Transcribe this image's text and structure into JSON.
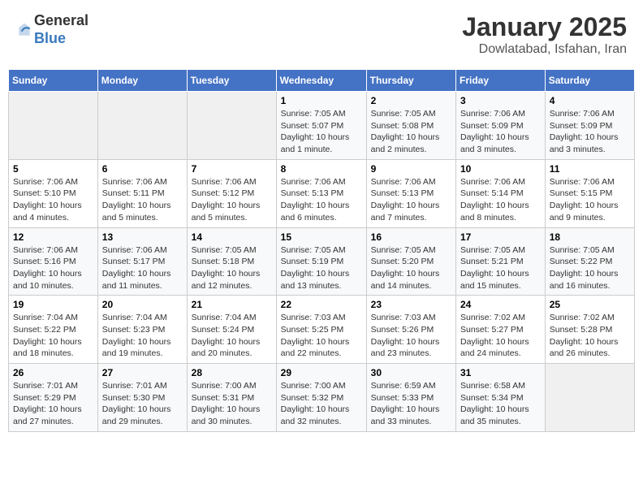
{
  "header": {
    "logo_general": "General",
    "logo_blue": "Blue",
    "title": "January 2025",
    "subtitle": "Dowlatabad, Isfahan, Iran"
  },
  "calendar": {
    "weekdays": [
      "Sunday",
      "Monday",
      "Tuesday",
      "Wednesday",
      "Thursday",
      "Friday",
      "Saturday"
    ],
    "weeks": [
      [
        {
          "day": "",
          "info": ""
        },
        {
          "day": "",
          "info": ""
        },
        {
          "day": "",
          "info": ""
        },
        {
          "day": "1",
          "info": "Sunrise: 7:05 AM\nSunset: 5:07 PM\nDaylight: 10 hours\nand 1 minute."
        },
        {
          "day": "2",
          "info": "Sunrise: 7:05 AM\nSunset: 5:08 PM\nDaylight: 10 hours\nand 2 minutes."
        },
        {
          "day": "3",
          "info": "Sunrise: 7:06 AM\nSunset: 5:09 PM\nDaylight: 10 hours\nand 3 minutes."
        },
        {
          "day": "4",
          "info": "Sunrise: 7:06 AM\nSunset: 5:09 PM\nDaylight: 10 hours\nand 3 minutes."
        }
      ],
      [
        {
          "day": "5",
          "info": "Sunrise: 7:06 AM\nSunset: 5:10 PM\nDaylight: 10 hours\nand 4 minutes."
        },
        {
          "day": "6",
          "info": "Sunrise: 7:06 AM\nSunset: 5:11 PM\nDaylight: 10 hours\nand 5 minutes."
        },
        {
          "day": "7",
          "info": "Sunrise: 7:06 AM\nSunset: 5:12 PM\nDaylight: 10 hours\nand 5 minutes."
        },
        {
          "day": "8",
          "info": "Sunrise: 7:06 AM\nSunset: 5:13 PM\nDaylight: 10 hours\nand 6 minutes."
        },
        {
          "day": "9",
          "info": "Sunrise: 7:06 AM\nSunset: 5:13 PM\nDaylight: 10 hours\nand 7 minutes."
        },
        {
          "day": "10",
          "info": "Sunrise: 7:06 AM\nSunset: 5:14 PM\nDaylight: 10 hours\nand 8 minutes."
        },
        {
          "day": "11",
          "info": "Sunrise: 7:06 AM\nSunset: 5:15 PM\nDaylight: 10 hours\nand 9 minutes."
        }
      ],
      [
        {
          "day": "12",
          "info": "Sunrise: 7:06 AM\nSunset: 5:16 PM\nDaylight: 10 hours\nand 10 minutes."
        },
        {
          "day": "13",
          "info": "Sunrise: 7:06 AM\nSunset: 5:17 PM\nDaylight: 10 hours\nand 11 minutes."
        },
        {
          "day": "14",
          "info": "Sunrise: 7:05 AM\nSunset: 5:18 PM\nDaylight: 10 hours\nand 12 minutes."
        },
        {
          "day": "15",
          "info": "Sunrise: 7:05 AM\nSunset: 5:19 PM\nDaylight: 10 hours\nand 13 minutes."
        },
        {
          "day": "16",
          "info": "Sunrise: 7:05 AM\nSunset: 5:20 PM\nDaylight: 10 hours\nand 14 minutes."
        },
        {
          "day": "17",
          "info": "Sunrise: 7:05 AM\nSunset: 5:21 PM\nDaylight: 10 hours\nand 15 minutes."
        },
        {
          "day": "18",
          "info": "Sunrise: 7:05 AM\nSunset: 5:22 PM\nDaylight: 10 hours\nand 16 minutes."
        }
      ],
      [
        {
          "day": "19",
          "info": "Sunrise: 7:04 AM\nSunset: 5:22 PM\nDaylight: 10 hours\nand 18 minutes."
        },
        {
          "day": "20",
          "info": "Sunrise: 7:04 AM\nSunset: 5:23 PM\nDaylight: 10 hours\nand 19 minutes."
        },
        {
          "day": "21",
          "info": "Sunrise: 7:04 AM\nSunset: 5:24 PM\nDaylight: 10 hours\nand 20 minutes."
        },
        {
          "day": "22",
          "info": "Sunrise: 7:03 AM\nSunset: 5:25 PM\nDaylight: 10 hours\nand 22 minutes."
        },
        {
          "day": "23",
          "info": "Sunrise: 7:03 AM\nSunset: 5:26 PM\nDaylight: 10 hours\nand 23 minutes."
        },
        {
          "day": "24",
          "info": "Sunrise: 7:02 AM\nSunset: 5:27 PM\nDaylight: 10 hours\nand 24 minutes."
        },
        {
          "day": "25",
          "info": "Sunrise: 7:02 AM\nSunset: 5:28 PM\nDaylight: 10 hours\nand 26 minutes."
        }
      ],
      [
        {
          "day": "26",
          "info": "Sunrise: 7:01 AM\nSunset: 5:29 PM\nDaylight: 10 hours\nand 27 minutes."
        },
        {
          "day": "27",
          "info": "Sunrise: 7:01 AM\nSunset: 5:30 PM\nDaylight: 10 hours\nand 29 minutes."
        },
        {
          "day": "28",
          "info": "Sunrise: 7:00 AM\nSunset: 5:31 PM\nDaylight: 10 hours\nand 30 minutes."
        },
        {
          "day": "29",
          "info": "Sunrise: 7:00 AM\nSunset: 5:32 PM\nDaylight: 10 hours\nand 32 minutes."
        },
        {
          "day": "30",
          "info": "Sunrise: 6:59 AM\nSunset: 5:33 PM\nDaylight: 10 hours\nand 33 minutes."
        },
        {
          "day": "31",
          "info": "Sunrise: 6:58 AM\nSunset: 5:34 PM\nDaylight: 10 hours\nand 35 minutes."
        },
        {
          "day": "",
          "info": ""
        }
      ]
    ]
  }
}
